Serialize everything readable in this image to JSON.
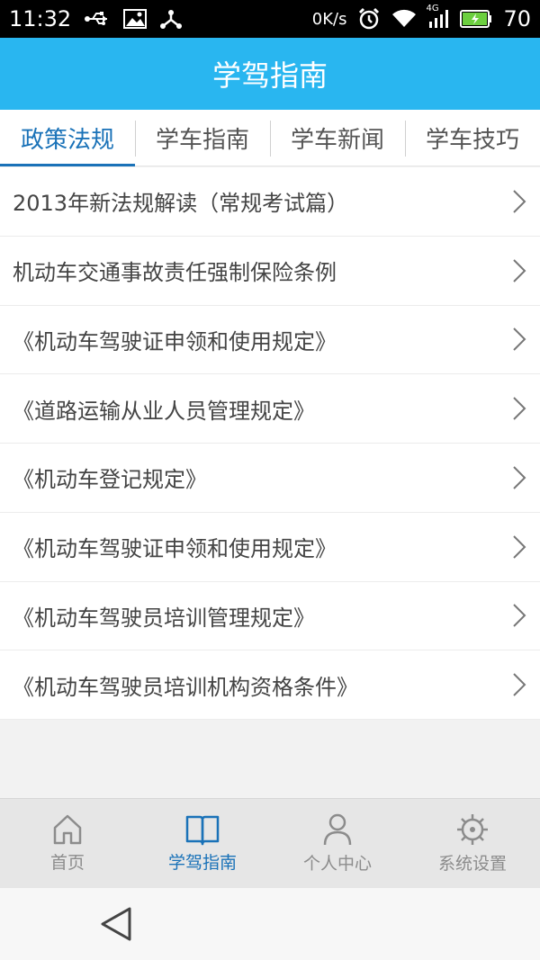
{
  "status_bar": {
    "time": "11:32",
    "speed": "0K/s",
    "network": "4G",
    "battery": "70",
    "icons": [
      "usb-icon",
      "image-icon",
      "network-share-icon",
      "alarm-icon",
      "wifi-icon",
      "signal-icon",
      "battery-charging-icon"
    ]
  },
  "app_bar": {
    "title": "学驾指南"
  },
  "tabs": [
    {
      "label": "政策法规",
      "active": true
    },
    {
      "label": "学车指南",
      "active": false
    },
    {
      "label": "学车新闻",
      "active": false
    },
    {
      "label": "学车技巧",
      "active": false
    }
  ],
  "list": [
    {
      "title": "2013年新法规解读（常规考试篇）"
    },
    {
      "title": "机动车交通事故责任强制保险条例"
    },
    {
      "title": "《机动车驾驶证申领和使用规定》"
    },
    {
      "title": "《道路运输从业人员管理规定》"
    },
    {
      "title": "《机动车登记规定》"
    },
    {
      "title": "《机动车驾驶证申领和使用规定》"
    },
    {
      "title": "《机动车驾驶员培训管理规定》"
    },
    {
      "title": "《机动车驾驶员培训机构资格条件》"
    }
  ],
  "bottom_nav": [
    {
      "label": "首页",
      "icon": "home-icon",
      "active": false
    },
    {
      "label": "学驾指南",
      "icon": "book-icon",
      "active": true
    },
    {
      "label": "个人中心",
      "icon": "person-icon",
      "active": false
    },
    {
      "label": "系统设置",
      "icon": "settings-icon",
      "active": false
    }
  ],
  "colors": {
    "app_bar": "#29b6f0",
    "active_tab": "#1a72b8",
    "inactive_nav": "#8c8c8c"
  }
}
